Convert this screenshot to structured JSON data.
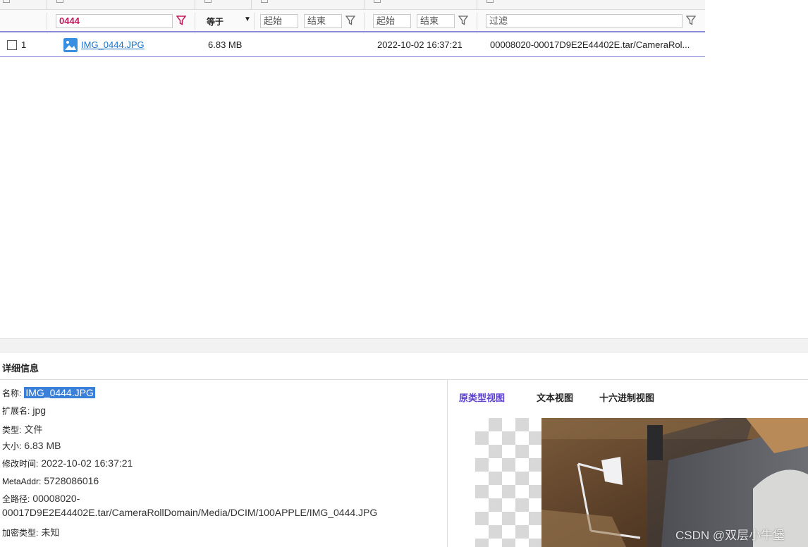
{
  "filter_row": {
    "name_filter": "0444",
    "size_operator": "等于",
    "created_start_placeholder": "起始",
    "created_end_placeholder": "结束",
    "modified_start_placeholder": "起始",
    "modified_end_placeholder": "结束",
    "path_filter_placeholder": "过滤"
  },
  "rows": [
    {
      "index": "1",
      "name": "IMG_0444.JPG",
      "size": "6.83 MB",
      "modified": "2022-10-02 16:37:21",
      "path": "00008020-00017D9E2E44402E.tar/CameraRol..."
    }
  ],
  "detail": {
    "title": "详细信息",
    "props": {
      "name_label": "名称:",
      "name_value": "IMG_0444.JPG",
      "ext_label": "扩展名:",
      "ext_value": "jpg",
      "type_label": "类型:",
      "type_value": "文件",
      "size_label": "大小:",
      "size_value": "6.83 MB",
      "mtime_label": "修改时间:",
      "mtime_value": "2022-10-02 16:37:21",
      "meta_label": "MetaAddr:",
      "meta_value": "5728086016",
      "path_label": "全路径:",
      "path_value_1": "00008020-",
      "path_value_2": "00017D9E2E44402E.tar/CameraRollDomain/Media/DCIM/100APPLE/IMG_0444.JPG",
      "enc_label": "加密类型:",
      "enc_value": "未知"
    },
    "tabs": [
      "原类型视图",
      "文本视图",
      "十六进制视图"
    ],
    "active_tab": 0
  },
  "watermark": "CSDN @双层小牛堡",
  "colors": {
    "accent": "#5b3fcf",
    "filter_highlight": "#c2185b",
    "link": "#1a73c9",
    "selection": "#3a7fd8"
  }
}
